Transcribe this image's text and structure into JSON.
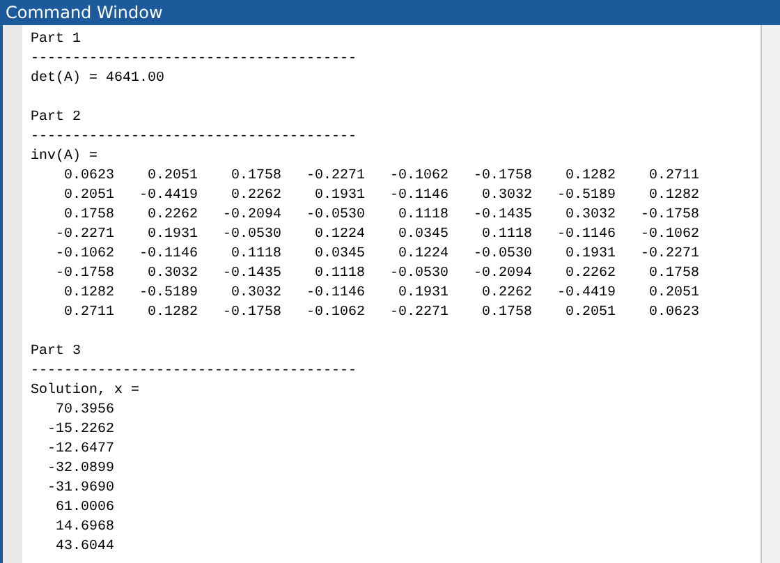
{
  "window": {
    "title": "Command Window"
  },
  "sections": [
    {
      "kind": "text",
      "heading": "Part 1",
      "rule": "---------------------------------------",
      "label": "det(A) = 4641.00"
    },
    {
      "kind": "matrix",
      "heading": "Part 2",
      "rule": "---------------------------------------",
      "label": "inv(A) =",
      "rows": [
        [
          "0.0623",
          "0.2051",
          "0.1758",
          "-0.2271",
          "-0.1062",
          "-0.1758",
          "0.1282",
          "0.2711"
        ],
        [
          "0.2051",
          "-0.4419",
          "0.2262",
          "0.1931",
          "-0.1146",
          "0.3032",
          "-0.5189",
          "0.1282"
        ],
        [
          "0.1758",
          "0.2262",
          "-0.2094",
          "-0.0530",
          "0.1118",
          "-0.1435",
          "0.3032",
          "-0.1758"
        ],
        [
          "-0.2271",
          "0.1931",
          "-0.0530",
          "0.1224",
          "0.0345",
          "0.1118",
          "-0.1146",
          "-0.1062"
        ],
        [
          "-0.1062",
          "-0.1146",
          "0.1118",
          "0.0345",
          "0.1224",
          "-0.0530",
          "0.1931",
          "-0.2271"
        ],
        [
          "-0.1758",
          "0.3032",
          "-0.1435",
          "0.1118",
          "-0.0530",
          "-0.2094",
          "0.2262",
          "0.1758"
        ],
        [
          "0.1282",
          "-0.5189",
          "0.3032",
          "-0.1146",
          "0.1931",
          "0.2262",
          "-0.4419",
          "0.2051"
        ],
        [
          "0.2711",
          "0.1282",
          "-0.1758",
          "-0.1062",
          "-0.2271",
          "0.1758",
          "0.2051",
          "0.0623"
        ]
      ]
    },
    {
      "kind": "vector",
      "heading": "Part 3",
      "rule": "---------------------------------------",
      "label": "Solution, x =",
      "values": [
        "70.3956",
        "-15.2262",
        "-12.6477",
        "-32.0899",
        "-31.9690",
        "61.0006",
        "14.6968",
        "43.6044"
      ]
    }
  ]
}
